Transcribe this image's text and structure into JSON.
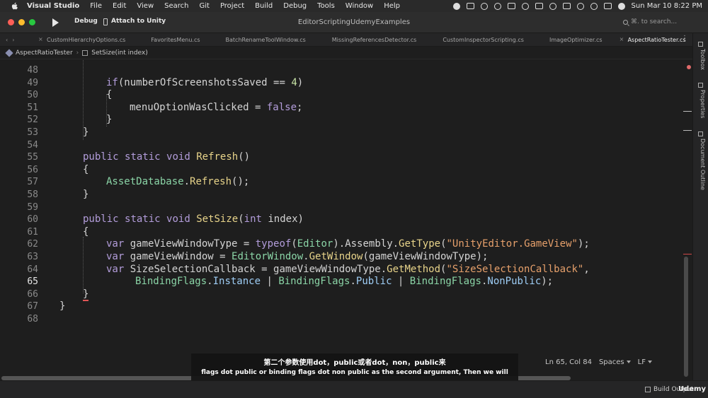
{
  "menubar": {
    "items": [
      "Visual Studio",
      "File",
      "Edit",
      "View",
      "Search",
      "Git",
      "Project",
      "Build",
      "Debug",
      "Tools",
      "Window",
      "Help"
    ],
    "clock": "Sun Mar 10  8:22 PM"
  },
  "toolbar": {
    "config": "Debug",
    "target": "Attach to Unity",
    "window_title": "EditorScriptingUdemyExamples",
    "search_placeholder": "⌘. to search..."
  },
  "tabs": [
    {
      "label": "CustomHierarchyOptions.cs",
      "active": false
    },
    {
      "label": "FavoritesMenu.cs",
      "active": false
    },
    {
      "label": "BatchRenameToolWindow.cs",
      "active": false
    },
    {
      "label": "MissingReferencesDetector.cs",
      "active": false
    },
    {
      "label": "CustomInspectorScripting.cs",
      "active": false
    },
    {
      "label": "ImageOptimizer.cs",
      "active": false
    },
    {
      "label": "AspectRatioTester.cs",
      "active": true
    }
  ],
  "breadcrumb": {
    "class_name": "AspectRatioTester",
    "method_name": "SetSize(int index)"
  },
  "editor": {
    "current_line": 65,
    "lines": [
      {
        "n": "48",
        "tokens": []
      },
      {
        "n": "49",
        "tokens": [
          [
            "kw",
            "if"
          ],
          [
            "pl",
            "("
          ],
          [
            "pl",
            "numberOfScreenshotsSaved == "
          ],
          [
            "num",
            "4"
          ],
          [
            "pl",
            ")"
          ]
        ]
      },
      {
        "n": "50",
        "tokens": [
          [
            "pl",
            "{"
          ]
        ]
      },
      {
        "n": "51",
        "tokens": [
          [
            "pl",
            "menuOptionWasClicked = "
          ],
          [
            "kw",
            "false"
          ],
          [
            "pl",
            ";"
          ]
        ]
      },
      {
        "n": "52",
        "tokens": [
          [
            "pl",
            "}"
          ]
        ]
      },
      {
        "n": "53",
        "tokens": [
          [
            "pl",
            "}"
          ]
        ]
      },
      {
        "n": "54",
        "tokens": []
      },
      {
        "n": "55",
        "tokens": [
          [
            "kw",
            "public"
          ],
          [
            "pl",
            " "
          ],
          [
            "kw",
            "static"
          ],
          [
            "pl",
            " "
          ],
          [
            "kw",
            "void"
          ],
          [
            "pl",
            " "
          ],
          [
            "fn",
            "Refresh"
          ],
          [
            "pl",
            "()"
          ]
        ]
      },
      {
        "n": "56",
        "tokens": [
          [
            "pl",
            "{"
          ]
        ]
      },
      {
        "n": "57",
        "tokens": [
          [
            "ty",
            "AssetDatabase"
          ],
          [
            "pl",
            "."
          ],
          [
            "fn",
            "Refresh"
          ],
          [
            "pl",
            "();"
          ]
        ]
      },
      {
        "n": "58",
        "tokens": [
          [
            "pl",
            "}"
          ]
        ]
      },
      {
        "n": "59",
        "tokens": []
      },
      {
        "n": "60",
        "tokens": [
          [
            "kw",
            "public"
          ],
          [
            "pl",
            " "
          ],
          [
            "kw",
            "static"
          ],
          [
            "pl",
            " "
          ],
          [
            "kw",
            "void"
          ],
          [
            "pl",
            " "
          ],
          [
            "fn",
            "SetSize"
          ],
          [
            "pl",
            "("
          ],
          [
            "kw",
            "int"
          ],
          [
            "pl",
            " index)"
          ]
        ]
      },
      {
        "n": "61",
        "tokens": [
          [
            "pl",
            "{"
          ]
        ]
      },
      {
        "n": "62",
        "tokens": [
          [
            "kw",
            "var"
          ],
          [
            "pl",
            " gameViewWindowType = "
          ],
          [
            "kw",
            "typeof"
          ],
          [
            "pl",
            "("
          ],
          [
            "ty",
            "Editor"
          ],
          [
            "pl",
            ")."
          ],
          [
            "pl",
            "Assembly."
          ],
          [
            "fn",
            "GetType"
          ],
          [
            "pl",
            "("
          ],
          [
            "str",
            "\"UnityEditor.GameView\""
          ],
          [
            "pl",
            ");"
          ]
        ]
      },
      {
        "n": "63",
        "tokens": [
          [
            "kw",
            "var"
          ],
          [
            "pl",
            " gameViewWindow = "
          ],
          [
            "ty",
            "EditorWindow"
          ],
          [
            "pl",
            "."
          ],
          [
            "fn",
            "GetWindow"
          ],
          [
            "pl",
            "(gameViewWindowType);"
          ]
        ]
      },
      {
        "n": "64",
        "tokens": [
          [
            "kw",
            "var"
          ],
          [
            "pl",
            " SizeSelectionCallback = gameViewWindowType."
          ],
          [
            "fn",
            "GetMethod"
          ],
          [
            "pl",
            "("
          ],
          [
            "str",
            "\"SizeSelectionCallback\""
          ],
          [
            "pl",
            ","
          ]
        ]
      },
      {
        "n": "65",
        "tokens": [
          [
            "ty",
            "BindingFlags"
          ],
          [
            "pl",
            "."
          ],
          [
            "prop",
            "Instance"
          ],
          [
            "pl",
            " | "
          ],
          [
            "ty",
            "BindingFlags"
          ],
          [
            "pl",
            "."
          ],
          [
            "prop",
            "Public"
          ],
          [
            "pl",
            " | "
          ],
          [
            "ty",
            "BindingFlags"
          ],
          [
            "pl",
            "."
          ],
          [
            "prop",
            "NonPublic"
          ],
          [
            "pl",
            ");"
          ]
        ]
      },
      {
        "n": "66",
        "tokens": [
          [
            "pl",
            "}"
          ]
        ]
      },
      {
        "n": "67",
        "tokens": [
          [
            "pl",
            "}"
          ]
        ]
      },
      {
        "n": "68",
        "tokens": []
      }
    ]
  },
  "status": {
    "position": "Ln 65, Col 84",
    "indent": "Spaces",
    "line_ending": "LF"
  },
  "side_panel": [
    "Toolbox",
    "Properties",
    "Document Outline"
  ],
  "bottom": {
    "build_output": "Build Output",
    "brand": "Udemy"
  },
  "subtitle": {
    "zh": "第二个参数使用dot，public或者dot，non，public来",
    "en": "flags dot public or binding flags dot non public as the second argument, Then we will"
  }
}
